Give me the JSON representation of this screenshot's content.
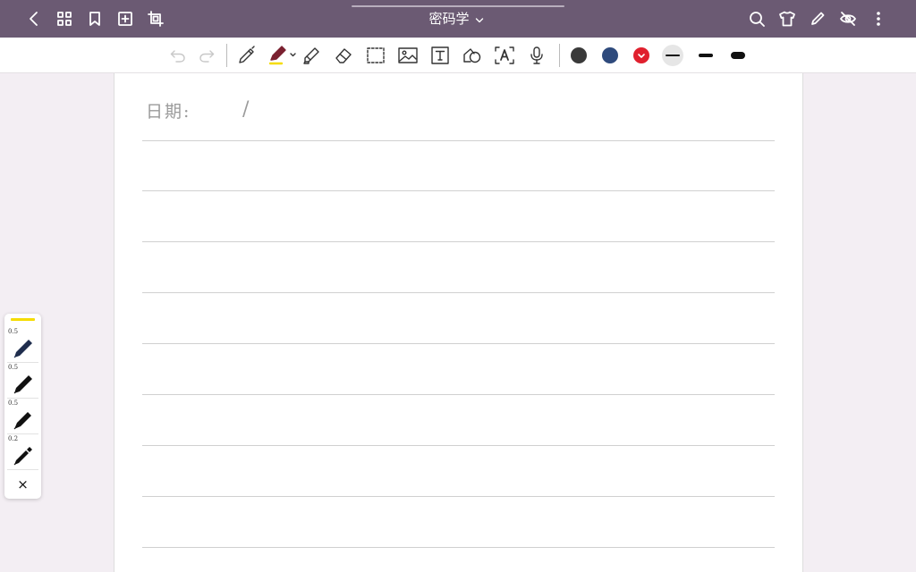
{
  "app": {
    "notebook_title": "密码学"
  },
  "topbar": {
    "left_icons": [
      "back-icon",
      "grid-view-icon",
      "bookmark-icon",
      "add-page-icon",
      "crop-icon"
    ],
    "right_icons": [
      "search-icon",
      "shirt-theme-icon",
      "pencil-icon",
      "eye-off-icon",
      "more-vertical-icon"
    ]
  },
  "toolbar": {
    "tools": [
      "undo-icon",
      "redo-icon",
      "pen-icon",
      "marker-icon",
      "highlighter-icon",
      "eraser-icon",
      "lasso-select-icon",
      "image-icon",
      "text-box-icon",
      "shape-icon",
      "ocr-text-icon",
      "microphone-icon"
    ],
    "colors": [
      "#3a3a3a",
      "#2e4a7c",
      "#e0202e"
    ],
    "selected_color": "#e0202e",
    "stroke_widths": [
      "thin",
      "medium",
      "thick"
    ],
    "selected_stroke": "thin"
  },
  "page": {
    "date_label": "日期:",
    "date_separator": "/"
  },
  "pen_palette": {
    "highlight_color": "#f5dc00",
    "pens": [
      {
        "size": "0.5",
        "color": "#1f2d4d"
      },
      {
        "size": "0.5",
        "color": "#111111"
      },
      {
        "size": "0.5",
        "color": "#111111"
      },
      {
        "size": "0.2",
        "color": "#111111"
      }
    ],
    "close_label": "×"
  }
}
